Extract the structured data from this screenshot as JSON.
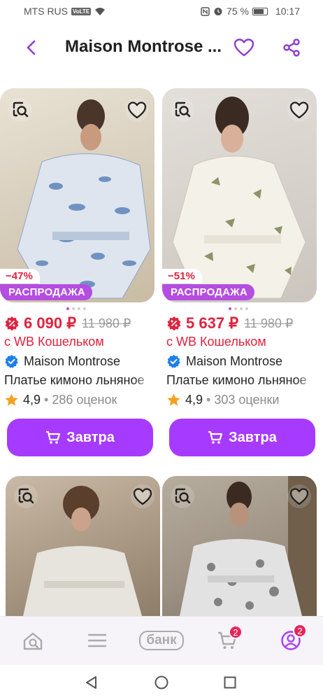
{
  "status": {
    "carrier": "MTS RUS",
    "volte": "VoLTE",
    "battery": "75 %",
    "time": "10:17"
  },
  "header": {
    "title": "Maison Montrose ..."
  },
  "products": [
    {
      "discount": "−47%",
      "badge": "РАСПРОДАЖА",
      "price": "6 090 ₽",
      "old_price": "11 980 ₽",
      "wallet": "с WB Кошельком",
      "brand": "Maison Montrose",
      "name": "Платье кимоно льняное",
      "rating": "4,9",
      "reviews": "286 оценок",
      "button": "Завтра"
    },
    {
      "discount": "−51%",
      "badge": "РАСПРОДАЖА",
      "price": "5 637 ₽",
      "old_price": "11 980 ₽",
      "wallet": "с WB Кошельком",
      "brand": "Maison Montrose",
      "name": "Платье кимоно льняное",
      "rating": "4,9",
      "reviews": "303 оценки",
      "button": "Завтра"
    }
  ],
  "bottom_nav": {
    "bank": "банк",
    "cart_badge": "2",
    "profile_badge": "2"
  },
  "colors": {
    "accent": "#a73aff",
    "sale": "#b44de0",
    "price": "#e0223f",
    "badge": "#e7245a"
  },
  "icons": [
    "back-arrow-icon",
    "heart-icon",
    "share-icon",
    "visual-search-icon",
    "verified-icon",
    "star-icon",
    "cart-icon",
    "home-icon",
    "menu-icon",
    "profile-icon"
  ]
}
